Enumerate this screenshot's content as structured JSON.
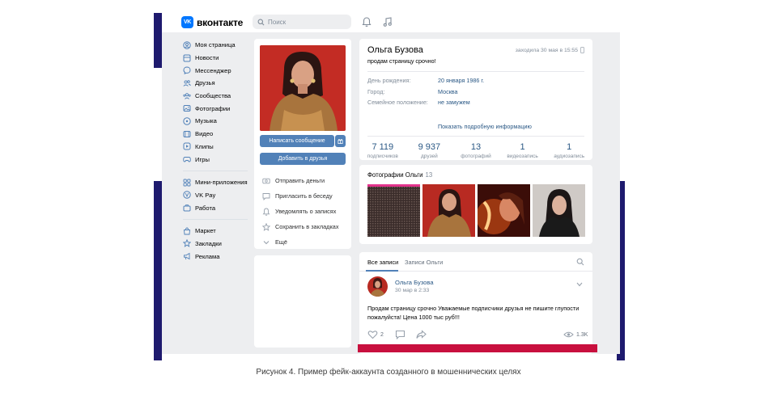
{
  "header": {
    "logo_mark": "VK",
    "logo_text": "вконтакте",
    "search_placeholder": "Поиск"
  },
  "menu": {
    "group1": [
      {
        "label": "Моя страница",
        "icon": "profile-icon"
      },
      {
        "label": "Новости",
        "icon": "news-icon"
      },
      {
        "label": "Мессенджер",
        "icon": "messenger-icon"
      },
      {
        "label": "Друзья",
        "icon": "friends-icon"
      },
      {
        "label": "Сообщества",
        "icon": "communities-icon"
      },
      {
        "label": "Фотографии",
        "icon": "photos-icon"
      },
      {
        "label": "Музыка",
        "icon": "music-icon"
      },
      {
        "label": "Видео",
        "icon": "video-icon"
      },
      {
        "label": "Клипы",
        "icon": "clips-icon"
      },
      {
        "label": "Игры",
        "icon": "games-icon"
      }
    ],
    "group2": [
      {
        "label": "Мини-приложения",
        "icon": "mini-apps-icon"
      },
      {
        "label": "VK Pay",
        "icon": "vkpay-icon"
      },
      {
        "label": "Работа",
        "icon": "work-icon"
      }
    ],
    "group3": [
      {
        "label": "Маркет",
        "icon": "market-icon"
      },
      {
        "label": "Закладки",
        "icon": "bookmarks-icon"
      },
      {
        "label": "Реклама",
        "icon": "ads-icon"
      }
    ]
  },
  "profile": {
    "write_message": "Написать сообщение",
    "add_friend": "Добавить в друзья",
    "actions": [
      {
        "label": "Отправить деньги",
        "icon": "money-icon"
      },
      {
        "label": "Пригласить в беседу",
        "icon": "invite-icon"
      },
      {
        "label": "Уведомлять о записях",
        "icon": "bell-icon"
      },
      {
        "label": "Сохранить в закладках",
        "icon": "star-icon"
      },
      {
        "label": "Ещё",
        "icon": "chevron-down-icon"
      }
    ]
  },
  "info": {
    "name": "Ольга Бузова",
    "status": "продам страницу срочно!",
    "online": "заходила 30 мая в 15:55",
    "rows": [
      {
        "key": "День рождения:",
        "value": "20 января 1986 г."
      },
      {
        "key": "Город:",
        "value": "Москва"
      },
      {
        "key": "Семейное положение:",
        "value": "не замужем"
      }
    ],
    "more": "Показать подробную информацию",
    "counters": [
      {
        "num": "7 119",
        "label": "подписчиков"
      },
      {
        "num": "9 937",
        "label": "друзей"
      },
      {
        "num": "13",
        "label": "фотографий"
      },
      {
        "num": "1",
        "label": "видеозапись"
      },
      {
        "num": "1",
        "label": "аудиозапись"
      }
    ]
  },
  "photos": {
    "title": "Фотографии Ольги",
    "count": "13"
  },
  "wall": {
    "tab_all": "Все записи",
    "tab_own": "Записи Ольги",
    "post": {
      "author": "Ольга Бузова",
      "date": "30 мар в 2:33",
      "text": "Продам страницу срочно Уважаемые подписчики друзья не пишите глупости пожалуйста! Цена 1000 тыс руб!!!",
      "likes": "2",
      "views": "1.3K"
    }
  },
  "caption": "Рисунок 4. Пример фейк-аккаунта созданного в мошеннических целях",
  "colors": {
    "accent": "#5181b8",
    "link": "#2a5885",
    "frame": "#1e1a6e",
    "frame_red": "#c8103e"
  }
}
